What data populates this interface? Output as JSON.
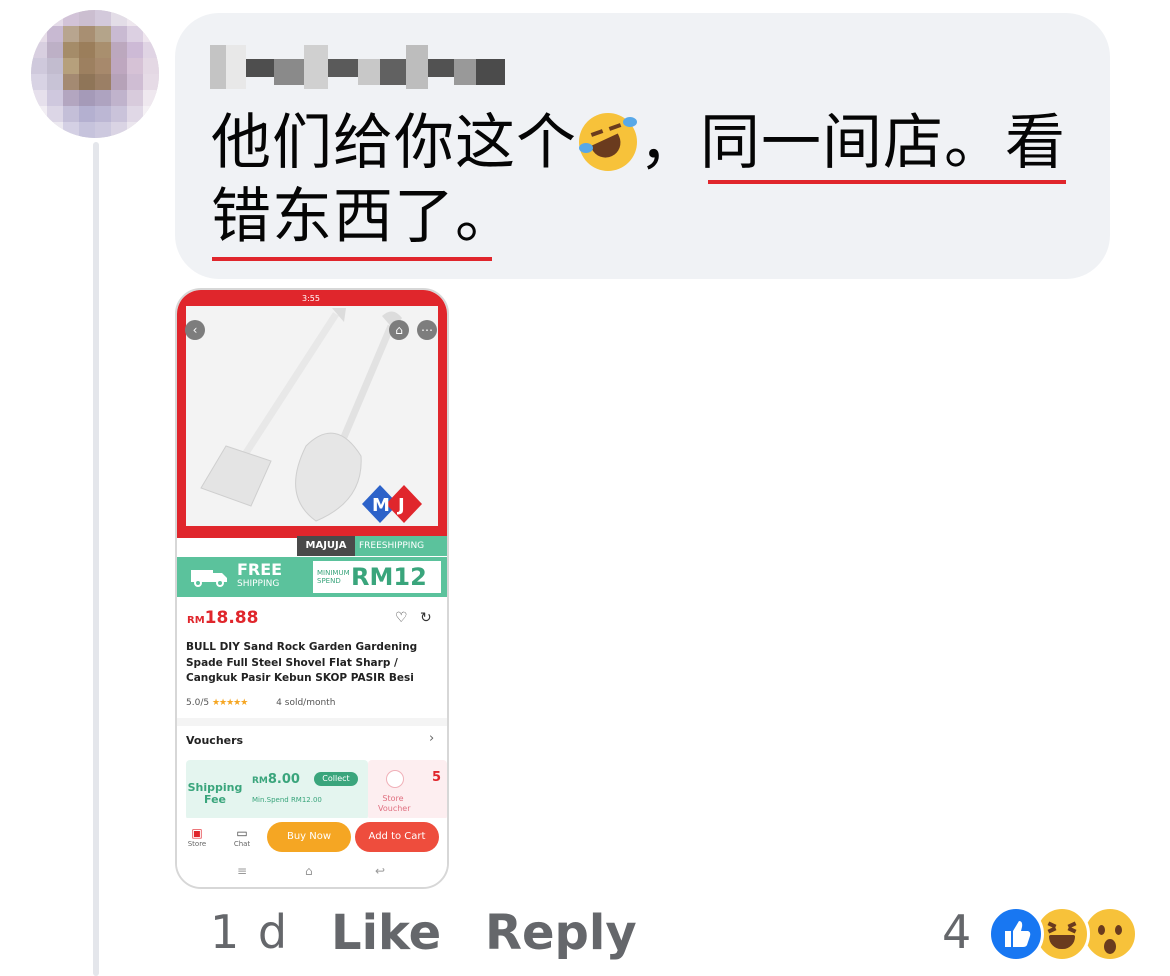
{
  "comment": {
    "text_line1_a": "他们给你这个",
    "text_line1_b": "，同一间店。看",
    "text_line2": "错东西了。",
    "emoji": "rolling-on-floor-laughing-icon"
  },
  "attachment": {
    "status_time": "3:55",
    "brand_tag": "MAJUJA",
    "free_shipping_tag": "FREESHIPPING",
    "banner_free": "FREE",
    "banner_shipping": "SHIPPING",
    "banner_min_spend": "MINIMUM SPEND",
    "banner_amount": "RM12",
    "price_currency": "RM",
    "price_value": "18.88",
    "product_title": "BULL DIY Sand Rock Garden Gardening Spade Full Steel Shovel Flat Sharp / Cangkuk Pasir Kebun SKOP PASIR Besi",
    "rating": "5.0/5",
    "stars": "★★★★★",
    "sold": "4 sold/month",
    "vouchers_label": "Vouchers",
    "voucher1_type": "Shipping Fee",
    "voucher1_currency": "RM",
    "voucher1_amount": "8.00",
    "voucher1_collect": "Collect",
    "voucher1_min": "Min.Spend RM12.00",
    "voucher2_type": "Store Voucher",
    "voucher2_amount": "5",
    "store_label": "Store",
    "chat_label": "Chat",
    "buy_now": "Buy Now",
    "add_to_cart": "Add to Cart"
  },
  "actions": {
    "time_ago": "1 d",
    "like": "Like",
    "reply": "Reply",
    "reaction_count": "4",
    "reactions": [
      "like-icon",
      "haha-icon",
      "wow-icon"
    ]
  },
  "colors": {
    "bubble": "#f0f2f5",
    "underline": "#e0262c",
    "action_text": "#65676b",
    "like_blue": "#1877f2"
  }
}
